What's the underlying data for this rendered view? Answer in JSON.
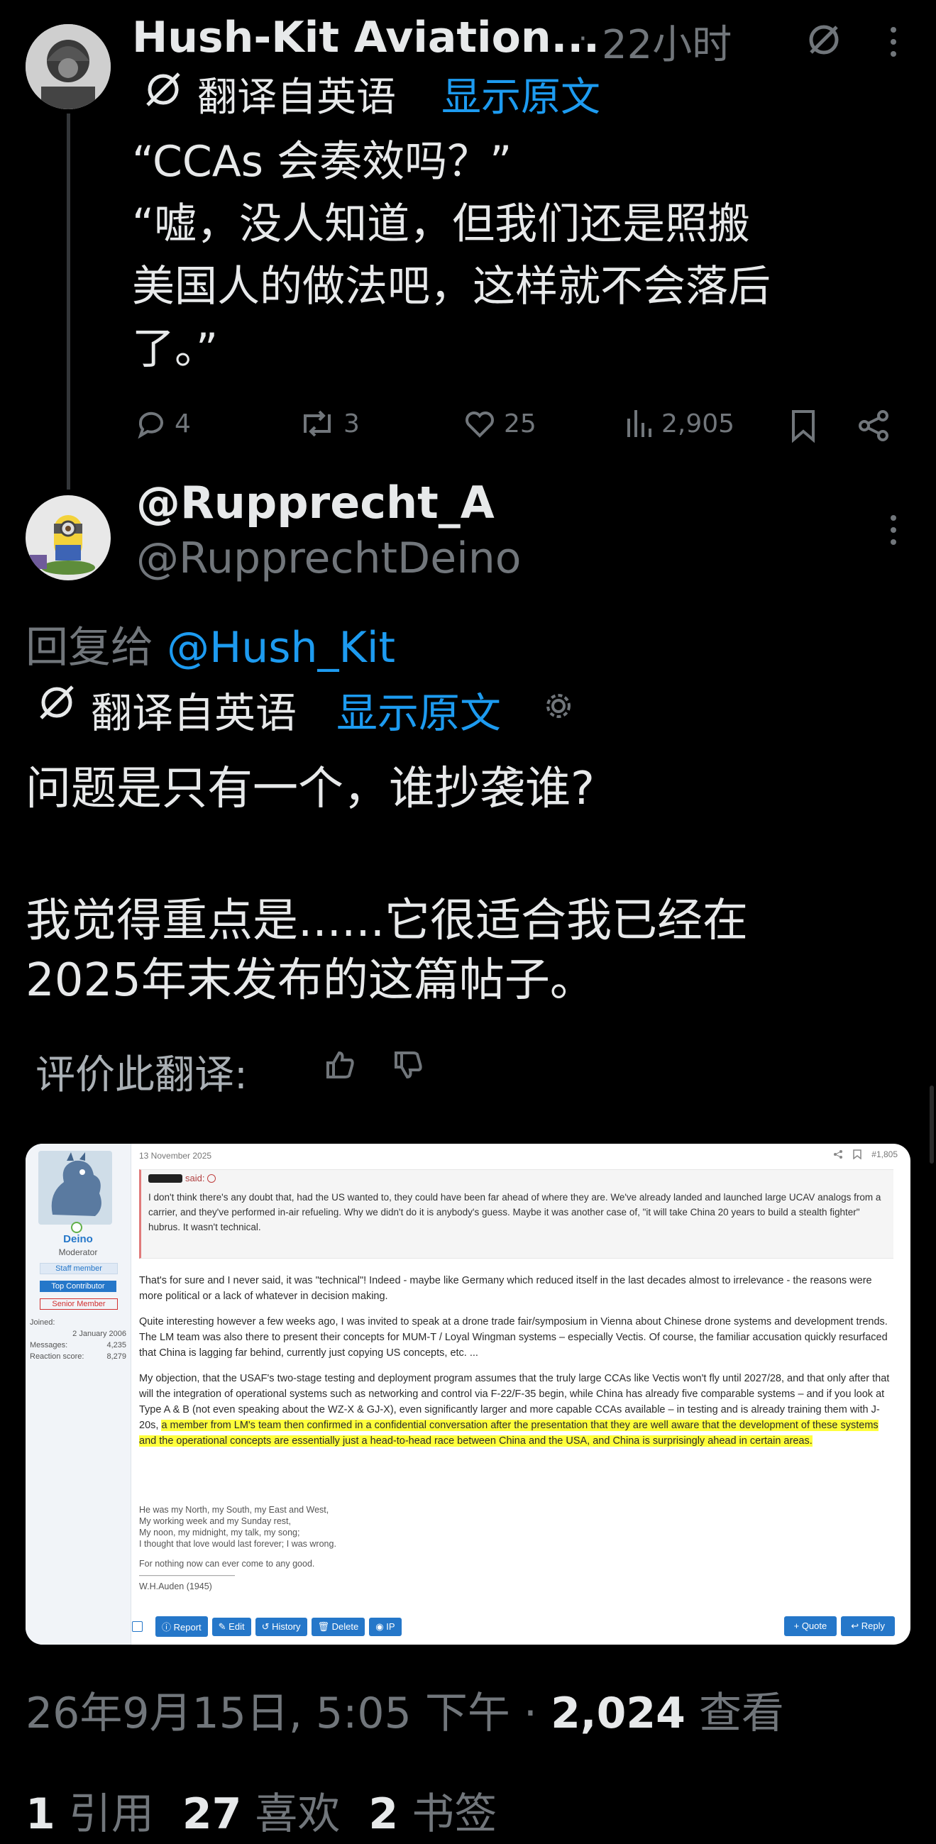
{
  "tweet1": {
    "name": "Hush-Kit Aviation...",
    "separator": "·",
    "time": "22小时",
    "translated_label": "翻译自英语",
    "show_original": "显示原文",
    "line1": "“CCAs 会奏效吗？”",
    "line2": "“嘘，没人知道，但我们还是照搬",
    "line3": "美国人的做法吧，这样就不会落后",
    "line4": "了。”",
    "replies": "4",
    "retweets": "3",
    "likes": "25",
    "views": "2,905"
  },
  "tweet2": {
    "display_name": "@Rupprecht_A",
    "handle": "@RupprechtDeino",
    "reply_to_label": "回复给",
    "reply_to_handle": "@Hush_Kit",
    "translated_label": "翻译自英语",
    "show_original": "显示原文",
    "para1": "问题是只有一个，谁抄袭谁?",
    "para2_line1": "我觉得重点是......它很适合我已经在",
    "para2_line2": "2025年末发布的这篇帖子。",
    "rate_label": "评价此翻译:",
    "timestamp": "26年9月15日, 5:05 下午",
    "dot": "·",
    "views_count": "2,024",
    "views_label": "查看",
    "quotes_count": "1",
    "quotes_label": "引用",
    "likes_count": "27",
    "likes_label": "喜欢",
    "bookmarks_count": "2",
    "bookmarks_label": "书签"
  },
  "forum": {
    "date": "13 November 2025",
    "post_number": "#1,805",
    "username": "Deino",
    "role": "Moderator",
    "badge1": "Staff member",
    "badge2": "Top Contributor",
    "badge3": "Senior Member",
    "joined_label": "Joined:",
    "joined_value": "2 January 2006",
    "messages_label": "Messages:",
    "messages_value": "4,235",
    "reaction_label": "Reaction score:",
    "reaction_value": "8,279",
    "quote_said": "said:",
    "quote_text": "I don't think there's any doubt that, had the US wanted to, they could have been far ahead of where they are. We've already landed and launched large UCAV analogs from a carrier, and they've performed in-air refueling. Why we didn't do it is anybody's guess. Maybe it was another case of, \"it will take China 20 years to build a stealth fighter\" hubrus. It wasn't technical.",
    "p1": "That's for sure and I never said, it was \"technical\"! Indeed - maybe like Germany which reduced itself in the last decades almost to irrelevance - the reasons were more political or a lack of whatever in decision making.",
    "p2": "Quite interesting however a few weeks ago, I was invited to speak at a drone trade fair/symposium in Vienna about Chinese drone systems and development trends. The LM team was also there to present their concepts for MUM-T / Loyal Wingman systems – especially Vectis. Of course, the familiar accusation quickly resurfaced that China is lagging far behind, currently just copying US concepts, etc. ...",
    "p3_plain": "My objection, that the USAF's two-stage testing and deployment program assumes that the truly large CCAs like Vectis won't fly until 2027/28, and that only after that will the integration of operational systems such as networking and control via F-22/F-35 begin, while China has already five comparable systems – and if you look at Type A & B (not even speaking about the WZ-X & GJ-X), even significantly larger and more capable CCAs available – in testing and is already training them with J-20s, ",
    "p3_highlight": "a member from LM's team then confirmed in a confidential conversation after the presentation that they are well aware that the development of these systems and the operational concepts are essentially just a head-to-head race between China and the USA, and China is surprisingly ahead in certain areas.",
    "sig1": "He was my North, my South, my East and West,",
    "sig2": "My working week and my Sunday rest,",
    "sig3": "My noon, my midnight, my talk, my song;",
    "sig4": "I thought that love would last forever; I was wrong.",
    "sig5": "For nothing now can ever come to any good.",
    "sig_rule": "———————————————",
    "sig6": "W.H.Auden (1945)",
    "btn_report": "Report",
    "btn_edit": "Edit",
    "btn_history": "History",
    "btn_delete": "Delete",
    "btn_ip": "IP",
    "btn_quote": "+ Quote",
    "btn_reply": "Reply"
  },
  "colors": {
    "background": "#000000",
    "text": "#e7e9ea",
    "muted": "#71767b",
    "link": "#1d9bf0",
    "highlight": "#ffff3c",
    "forum_button": "#2577c9"
  }
}
